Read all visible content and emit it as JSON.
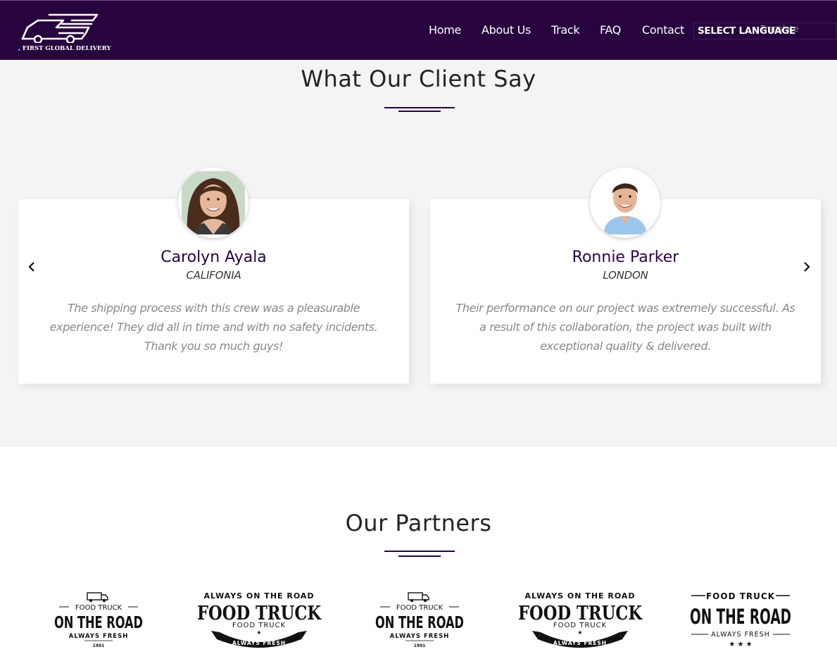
{
  "header": {
    "logo_text": ", FIRST GLOBAL DELIVERY",
    "nav": [
      "Home",
      "About Us",
      "Track",
      "FAQ",
      "Contact"
    ],
    "language_label": "SELECT LANGUAGE",
    "language_widget_text": "Translate"
  },
  "testimonials": {
    "title": "What Our Client Say",
    "clients": [
      {
        "name": "Carolyn Ayala",
        "location": "CALIFONIA",
        "quote": "The shipping process with this crew was a pleasurable experience! They did all in time and with no safety incidents. Thank you so much guys!"
      },
      {
        "name": "Ronnie Parker",
        "location": "LONDON",
        "quote": "Their performance on our project was extremely successful. As a result of this collaboration, the project was built with exceptional quality & delivered."
      }
    ]
  },
  "partners": {
    "title": "Our Partners",
    "logos": [
      {
        "top": "FOOD TRUCK",
        "main": "ON THE ROAD",
        "sub": "ALWAYS FRESH",
        "year": "1991"
      },
      {
        "top": "ALWAYS ON THE ROAD",
        "main": "FOOD TRUCK",
        "sub": "FOOD TRUCK",
        "ribbon": "ALWAYS FRESH"
      },
      {
        "top": "FOOD TRUCK",
        "main": "ON THE ROAD",
        "sub": "ALWAYS FRESH",
        "year": "1991"
      },
      {
        "top": "ALWAYS ON THE ROAD",
        "main": "FOOD TRUCK",
        "sub": "FOOD TRUCK",
        "ribbon": "ALWAYS FRESH"
      },
      {
        "top": "FOOD TRUCK",
        "main": "ON THE ROAD",
        "sub": "ALWAYS FRESH"
      }
    ]
  },
  "colors": {
    "brand": "#28043f",
    "section_bg": "#f4f4f4",
    "quote_text": "#888888"
  }
}
